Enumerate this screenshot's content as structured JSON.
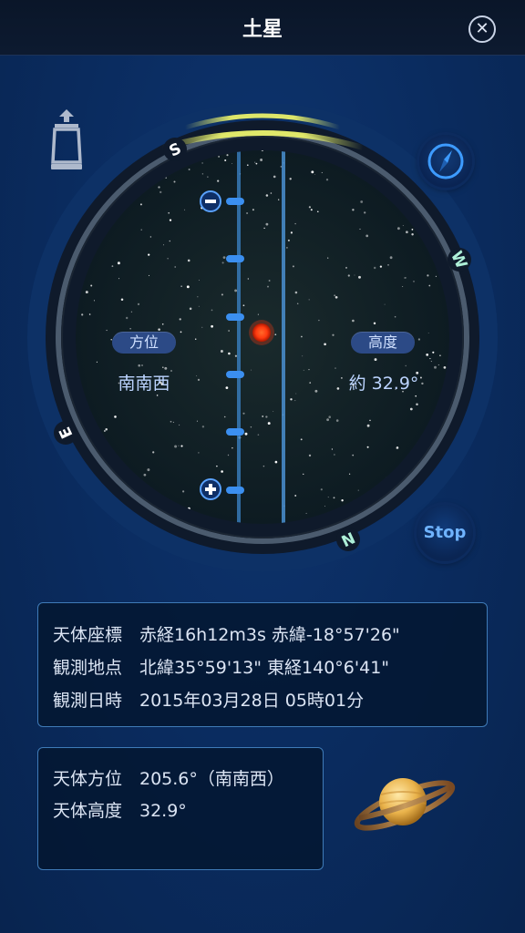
{
  "header": {
    "title": "土星",
    "close_icon": "close-icon"
  },
  "dial": {
    "compass_letters": {
      "s": "S",
      "w": "W",
      "n": "N",
      "e": "E"
    },
    "azimuth_label": "方位",
    "azimuth_value": "南南西",
    "altitude_label": "高度",
    "altitude_value": "約 32.9°",
    "zoom_out_icon": "minus-icon",
    "zoom_in_icon": "plus-icon"
  },
  "buttons": {
    "compass_icon": "compass-icon",
    "stop_label": "Stop"
  },
  "info_panel": {
    "line1": "天体座標　赤経16h12m3s 赤緯-18°57'26\"",
    "line2": "観測地点　北緯35°59'13\" 東経140°6'41\"",
    "line3": "観測日時　2015年03月28日 05時01分"
  },
  "position_panel": {
    "line1": "天体方位　205.6°（南南西）",
    "line2": "天体高度　32.9°"
  },
  "colors": {
    "background": "#0b2a5a",
    "accent": "#3f7bb8",
    "planet_dot": "#ff3b10",
    "glow": "#e8f06a"
  }
}
